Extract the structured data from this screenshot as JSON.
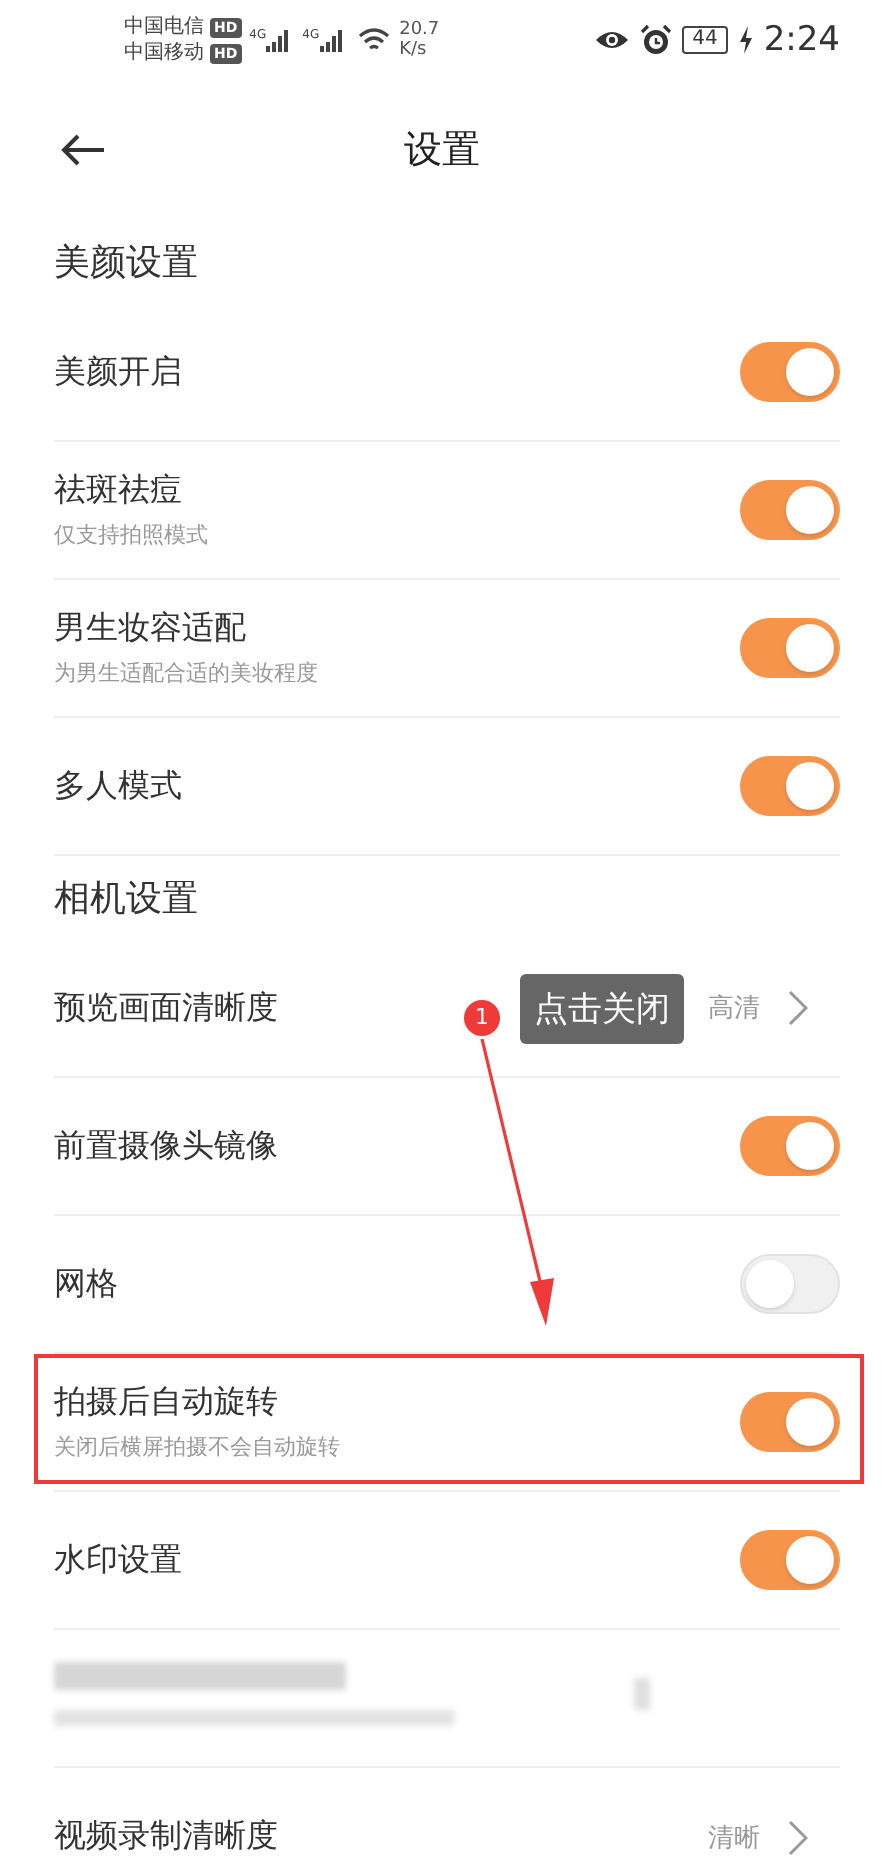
{
  "status_bar": {
    "carriers": [
      {
        "name": "中国电信",
        "badge": "HD",
        "network": "4G"
      },
      {
        "name": "中国移动",
        "badge": "HD",
        "network": "4G"
      }
    ],
    "speed": "20.7",
    "speed_unit": "K/s",
    "battery": "44",
    "time": "2:24"
  },
  "header": {
    "title": "设置"
  },
  "items": [
    {
      "kind": "section",
      "title": "美颜设置"
    },
    {
      "kind": "toggle",
      "title": "美颜开启",
      "on": true
    },
    {
      "kind": "toggle",
      "title": "祛斑祛痘",
      "subtitle": "仅支持拍照模式",
      "on": true
    },
    {
      "kind": "toggle",
      "title": "男生妆容适配",
      "subtitle": "为男生适配合适的美妆程度",
      "on": true
    },
    {
      "kind": "toggle",
      "title": "多人模式",
      "on": true
    },
    {
      "kind": "section",
      "title": "相机设置"
    },
    {
      "kind": "link",
      "title": "预览画面清晰度",
      "value": "高清"
    },
    {
      "kind": "toggle",
      "title": "前置摄像头镜像",
      "on": true
    },
    {
      "kind": "toggle",
      "title": "网格",
      "on": false
    },
    {
      "kind": "toggle",
      "title": "拍摄后自动旋转",
      "subtitle": "关闭后横屏拍摄不会自动旋转",
      "on": true,
      "highlighted": true
    },
    {
      "kind": "toggle",
      "title": "水印设置",
      "on": true
    },
    {
      "kind": "redacted"
    },
    {
      "kind": "link",
      "title": "视频录制清晰度",
      "value": "清晰"
    }
  ],
  "annotation": {
    "step": "1",
    "text": "点击关闭"
  }
}
